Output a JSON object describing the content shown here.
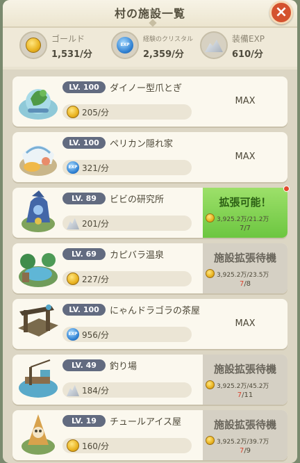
{
  "header": {
    "title": "村の施設一覧",
    "close_label": "×"
  },
  "stats": {
    "gold": {
      "label": "ゴールド",
      "value": "1,531/分",
      "icon": "gold-coin-icon"
    },
    "crystal": {
      "label": "経験のクリスタル",
      "value": "2,359/分",
      "icon": "exp-crystal-icon",
      "icon_text": "EXP"
    },
    "equip": {
      "label": "装備EXP",
      "value": "610/分",
      "icon": "ore-icon"
    }
  },
  "facilities": [
    {
      "level": "LV. 100",
      "name": "ダイノー型爪とぎ",
      "rate": "205/分",
      "resource": "gold",
      "status": "MAX"
    },
    {
      "level": "LV. 100",
      "name": "ペリカン隠れ家",
      "rate": "321/分",
      "resource": "crystal",
      "status": "MAX"
    },
    {
      "level": "LV. 89",
      "name": "ビビの研究所",
      "rate": "201/分",
      "resource": "ore",
      "status": "ready",
      "action_title": "拡張可能！",
      "cost": "3,925.2万/21.2万",
      "count_current": "7",
      "count_total": "/7"
    },
    {
      "level": "LV. 69",
      "name": "カピバラ温泉",
      "rate": "227/分",
      "resource": "gold",
      "status": "wait",
      "action_title": "施設拡張待機",
      "cost": "3,925.2万/23.5万",
      "count_current": "7",
      "count_total": "/8"
    },
    {
      "level": "LV. 100",
      "name": "にゃんドラゴラの茶屋",
      "rate": "956/分",
      "resource": "crystal",
      "status": "MAX"
    },
    {
      "level": "LV. 49",
      "name": "釣り場",
      "rate": "184/分",
      "resource": "ore",
      "status": "wait",
      "action_title": "施設拡張待機",
      "cost": "3,925.2万/45.2万",
      "count_current": "7",
      "count_total": "/11"
    },
    {
      "level": "LV. 19",
      "name": "チュールアイス屋",
      "rate": "160/分",
      "resource": "gold",
      "status": "wait",
      "action_title": "施設拡張待機",
      "cost": "3,925.2万/39.7万",
      "count_current": "7",
      "count_total": "/9"
    }
  ],
  "colors": {
    "ready": "#7fd14f",
    "wait": "#d5d0c4",
    "level_badge": "#626b80",
    "close": "#d4522e",
    "red_count": "#d8432e"
  }
}
